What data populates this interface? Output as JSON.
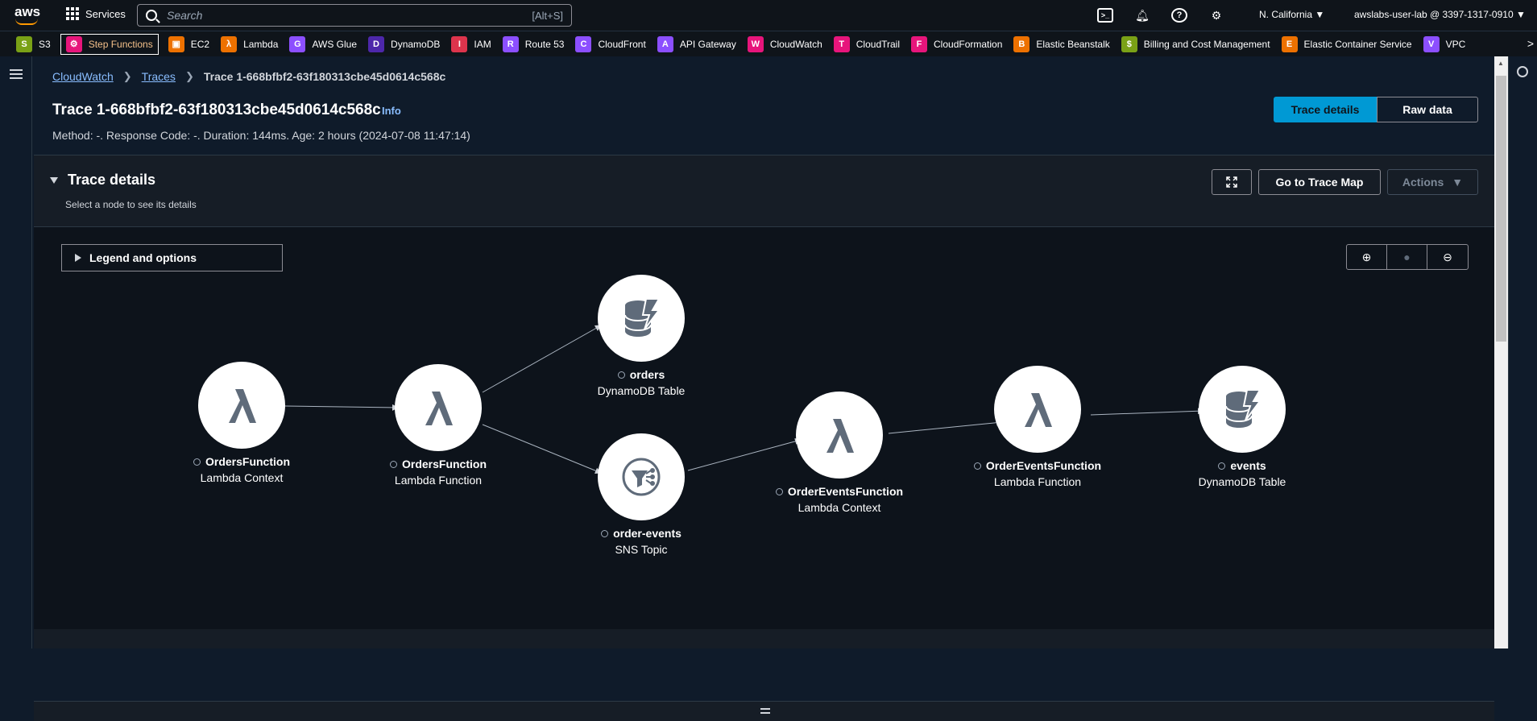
{
  "topnav": {
    "logo": "aws",
    "services_label": "Services",
    "search_placeholder": "Search",
    "search_shortcut": "[Alt+S]",
    "region": "N. California ▼",
    "account": "awslabs-user-lab @ 3397-1317-0910 ▼",
    "icons": [
      "cloudshell-icon",
      "notifications-icon",
      "help-icon",
      "settings-icon"
    ]
  },
  "favorites": [
    {
      "label": "S3",
      "color": "#7aa116",
      "icon": "S"
    },
    {
      "label": "Step Functions",
      "color": "#e7157b",
      "icon": "⚙",
      "selected": true
    },
    {
      "label": "EC2",
      "color": "#ed7100",
      "icon": "▣"
    },
    {
      "label": "Lambda",
      "color": "#ed7100",
      "icon": "λ"
    },
    {
      "label": "AWS Glue",
      "color": "#8c4fff",
      "icon": "G"
    },
    {
      "label": "DynamoDB",
      "color": "#4d27aa",
      "icon": "D"
    },
    {
      "label": "IAM",
      "color": "#dd344c",
      "icon": "I"
    },
    {
      "label": "Route 53",
      "color": "#8c4fff",
      "icon": "R"
    },
    {
      "label": "CloudFront",
      "color": "#8c4fff",
      "icon": "C"
    },
    {
      "label": "API Gateway",
      "color": "#8c4fff",
      "icon": "A"
    },
    {
      "label": "CloudWatch",
      "color": "#e7157b",
      "icon": "W"
    },
    {
      "label": "CloudTrail",
      "color": "#e7157b",
      "icon": "T"
    },
    {
      "label": "CloudFormation",
      "color": "#e7157b",
      "icon": "F"
    },
    {
      "label": "Elastic Beanstalk",
      "color": "#ed7100",
      "icon": "B"
    },
    {
      "label": "Billing and Cost Management",
      "color": "#7aa116",
      "icon": "$"
    },
    {
      "label": "Elastic Container Service",
      "color": "#ed7100",
      "icon": "E"
    },
    {
      "label": "VPC",
      "color": "#8c4fff",
      "icon": "V"
    }
  ],
  "breadcrumb": {
    "item1": "CloudWatch",
    "item2": "Traces",
    "current": "Trace 1-668bfbf2-63f180313cbe45d0614c568c"
  },
  "header": {
    "title": "Trace 1-668bfbf2-63f180313cbe45d0614c568c",
    "info": "Info",
    "meta": "Method: -. Response Code: -. Duration: 144ms. Age: 2 hours (2024-07-08 11:47:14)",
    "tab_trace_details": "Trace details",
    "tab_raw_data": "Raw data"
  },
  "section": {
    "title": "Trace details",
    "subtitle": "Select a node to see its details",
    "go_to_map": "Go to Trace Map",
    "actions": "Actions"
  },
  "graph": {
    "legend_label": "Legend and options",
    "zoom_in": "⊕",
    "zoom_reset": "●",
    "zoom_out": "⊖",
    "nodes": [
      {
        "name": "OrdersFunction",
        "type": "Lambda Context",
        "icon": "lambda-icon"
      },
      {
        "name": "OrdersFunction",
        "type": "Lambda Function",
        "icon": "lambda-icon"
      },
      {
        "name": "orders",
        "type": "DynamoDB Table",
        "icon": "dynamodb-icon"
      },
      {
        "name": "order-events",
        "type": "SNS Topic",
        "icon": "sns-icon"
      },
      {
        "name": "OrderEventsFunction",
        "type": "Lambda Context",
        "icon": "lambda-icon"
      },
      {
        "name": "OrderEventsFunction",
        "type": "Lambda Function",
        "icon": "lambda-icon"
      },
      {
        "name": "events",
        "type": "DynamoDB Table",
        "icon": "dynamodb-icon"
      }
    ]
  }
}
